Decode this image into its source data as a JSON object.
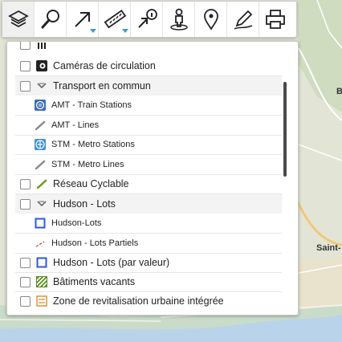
{
  "toolbar": {
    "buttons": [
      {
        "name": "layers-button",
        "icon": "layers-icon",
        "active": true,
        "caret": false
      },
      {
        "name": "search-button",
        "icon": "magnifier-icon",
        "active": false,
        "caret": false
      },
      {
        "name": "navigate-button",
        "icon": "arrow-icon",
        "active": false,
        "caret": true
      },
      {
        "name": "measure-button",
        "icon": "ruler-icon",
        "active": false,
        "caret": true
      },
      {
        "name": "identify-button",
        "icon": "info-arrow-icon",
        "active": false,
        "caret": false
      },
      {
        "name": "street-view-button",
        "icon": "pegman-icon",
        "active": false,
        "caret": false
      },
      {
        "name": "locate-button",
        "icon": "map-pin-icon",
        "active": false,
        "caret": false
      },
      {
        "name": "draw-button",
        "icon": "pencil-icon",
        "active": false,
        "caret": false
      },
      {
        "name": "print-button",
        "icon": "printer-icon",
        "active": false,
        "caret": false
      }
    ]
  },
  "map": {
    "labels": [
      "B",
      "Saint-"
    ]
  },
  "layers": [
    {
      "label": "Caméras de circulation",
      "kind": "layer",
      "icon": "camera-icon"
    },
    {
      "label": "Transport en commun",
      "kind": "group",
      "icon": "chevron-down-icon"
    },
    {
      "label": "AMT - Train Stations",
      "kind": "sub",
      "icon": "train-station-icon"
    },
    {
      "label": "AMT - Lines",
      "kind": "sub",
      "icon": "line-gray-icon"
    },
    {
      "label": "STM - Metro Stations",
      "kind": "sub",
      "icon": "metro-icon"
    },
    {
      "label": "STM - Metro Lines",
      "kind": "sub",
      "icon": "line-gray-icon"
    },
    {
      "label": "Réseau Cyclable",
      "kind": "layer",
      "icon": "line-green-icon"
    },
    {
      "label": "Hudson - Lots",
      "kind": "group",
      "icon": "chevron-down-icon"
    },
    {
      "label": "Hudson-Lots",
      "kind": "sub",
      "icon": "blue-square-icon"
    },
    {
      "label": "Hudson - Lots Partiels",
      "kind": "sub",
      "icon": "dashed-red-icon"
    },
    {
      "label": "Hudson - Lots (par valeur)",
      "kind": "layer",
      "icon": "blue-square-icon"
    },
    {
      "label": "Bâtiments vacants",
      "kind": "layer",
      "icon": "hatched-green-icon"
    },
    {
      "label": "Zone de revitalisation urbaine intégrée",
      "kind": "layer",
      "icon": "hatched-orange-icon"
    }
  ],
  "colors": {
    "accent": "#3a9bd1",
    "lot_blue": "#2a5bd7",
    "bike_green": "#6a9a1f"
  }
}
